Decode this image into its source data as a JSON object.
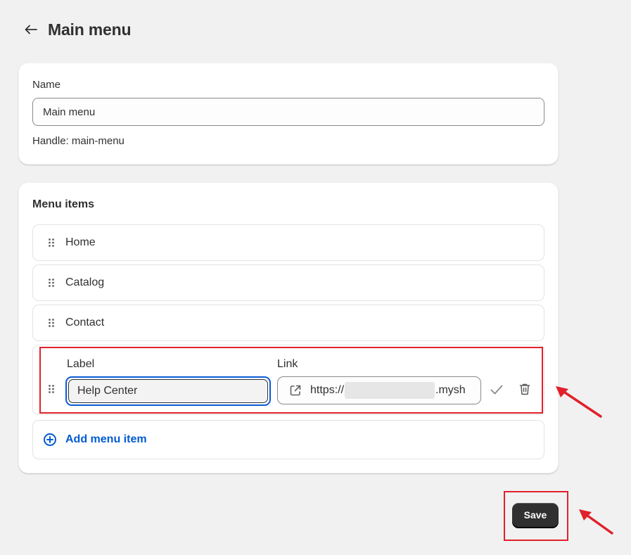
{
  "header": {
    "title": "Main menu",
    "back_icon": "arrow-left-icon"
  },
  "name_card": {
    "label": "Name",
    "value": "Main menu",
    "handle": "Handle: main-menu"
  },
  "menu_items": {
    "title": "Menu items",
    "items": [
      {
        "label": "Home"
      },
      {
        "label": "Catalog"
      },
      {
        "label": "Contact"
      }
    ],
    "editing": {
      "label_title": "Label",
      "link_title": "Link",
      "label_value": "Help Center",
      "link_prefix": "https://",
      "link_suffix": ".mysh"
    },
    "add_label": "Add menu item"
  },
  "footer": {
    "save_label": "Save"
  },
  "colors": {
    "accent": "#005bd3",
    "focus_ring": "#0b5bd3",
    "annotation": "#e0212b",
    "primary_button": "#303030"
  }
}
